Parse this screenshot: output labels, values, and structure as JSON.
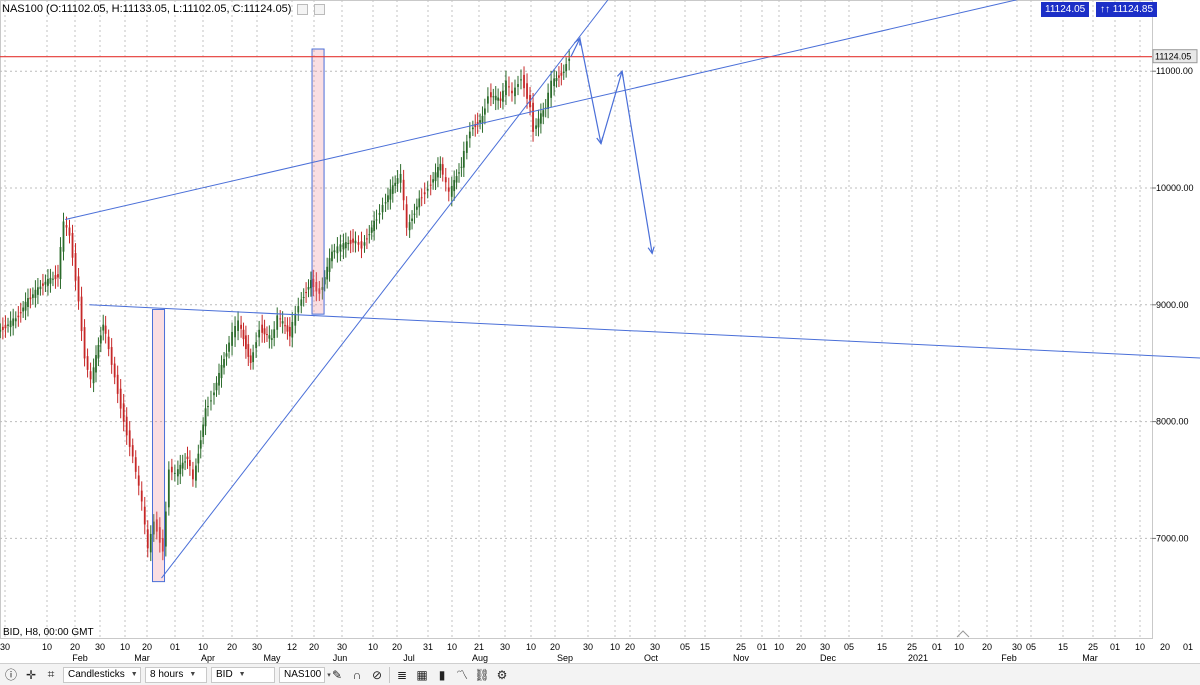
{
  "header": {
    "ohlc_text": "NAS100 (O:11102.05, H:11133.05, L:11102.05, C:11124.05)"
  },
  "badges": {
    "bid_price": "11124.05",
    "ask_price": "11124.85",
    "ask_arrows": "↑↑"
  },
  "footer_label": "BID, H8, 00:00 GMT",
  "chart_data": {
    "type": "candlestick",
    "symbol": "NAS100",
    "timeframe": "H8",
    "current_price": 11124.05,
    "price_ticks": [
      "11124.05",
      "11000.00",
      "10000.00",
      "9000.00",
      "8000.00",
      "7000.00"
    ],
    "date_ticks": [
      "30",
      "10",
      "20",
      "30",
      "10",
      "20",
      "01",
      "10",
      "20",
      "30",
      "12",
      "20",
      "30",
      "10",
      "20",
      "31",
      "10",
      "21",
      "30",
      "10",
      "20",
      "30",
      "10",
      "20",
      "30",
      "05",
      "15",
      "25",
      "01",
      "10",
      "20",
      "30",
      "05",
      "15",
      "25",
      "01",
      "10",
      "20",
      "30",
      "05",
      "15",
      "25",
      "01",
      "10",
      "20",
      "01",
      "10",
      "20"
    ],
    "month_labels": [
      "Feb",
      "Mar",
      "Apr",
      "May",
      "Jun",
      "Jul",
      "Aug",
      "Sep",
      "Oct",
      "Nov",
      "Dec",
      "2021",
      "Feb",
      "Mar"
    ],
    "ylim": [
      6350,
      11650
    ],
    "series": [
      {
        "points": [
          [
            "2020-01-28",
            8770
          ],
          [
            "2020-02-03",
            8880
          ],
          [
            "2020-02-07",
            9040
          ],
          [
            "2020-02-12",
            9180
          ],
          [
            "2020-02-17",
            9250
          ],
          [
            "2020-02-19",
            9700
          ],
          [
            "2020-02-21",
            9600
          ],
          [
            "2020-02-24",
            9040
          ],
          [
            "2020-02-26",
            8550
          ],
          [
            "2020-02-28",
            8350
          ],
          [
            "2020-03-03",
            8850
          ],
          [
            "2020-03-06",
            8500
          ],
          [
            "2020-03-09",
            8130
          ],
          [
            "2020-03-11",
            7900
          ],
          [
            "2020-03-13",
            7700
          ],
          [
            "2020-03-16",
            7300
          ],
          [
            "2020-03-18",
            6900
          ],
          [
            "2020-03-20",
            7150
          ],
          [
            "2020-03-23",
            6900
          ],
          [
            "2020-03-25",
            7600
          ],
          [
            "2020-03-27",
            7550
          ],
          [
            "2020-03-31",
            7700
          ],
          [
            "2020-04-02",
            7500
          ],
          [
            "2020-04-06",
            8100
          ],
          [
            "2020-04-08",
            8200
          ],
          [
            "2020-04-13",
            8600
          ],
          [
            "2020-04-15",
            8750
          ],
          [
            "2020-04-17",
            8850
          ],
          [
            "2020-04-21",
            8500
          ],
          [
            "2020-04-24",
            8800
          ],
          [
            "2020-04-28",
            8700
          ],
          [
            "2020-04-30",
            8900
          ],
          [
            "2020-05-04",
            8750
          ],
          [
            "2020-05-07",
            9000
          ],
          [
            "2020-05-11",
            9200
          ],
          [
            "2020-05-14",
            9100
          ],
          [
            "2020-05-18",
            9450
          ],
          [
            "2020-05-21",
            9500
          ],
          [
            "2020-05-25",
            9550
          ],
          [
            "2020-05-28",
            9500
          ],
          [
            "2020-06-01",
            9700
          ],
          [
            "2020-06-04",
            9850
          ],
          [
            "2020-06-08",
            10050
          ],
          [
            "2020-06-10",
            10100
          ],
          [
            "2020-06-12",
            9650
          ],
          [
            "2020-06-16",
            9900
          ],
          [
            "2020-06-19",
            10000
          ],
          [
            "2020-06-23",
            10200
          ],
          [
            "2020-06-26",
            9950
          ],
          [
            "2020-06-30",
            10200
          ],
          [
            "2020-07-03",
            10500
          ],
          [
            "2020-07-07",
            10600
          ],
          [
            "2020-07-09",
            10800
          ],
          [
            "2020-07-13",
            10750
          ],
          [
            "2020-07-15",
            10900
          ],
          [
            "2020-07-17",
            10800
          ],
          [
            "2020-07-20",
            10950
          ],
          [
            "2020-07-23",
            10700
          ],
          [
            "2020-07-24",
            10500
          ],
          [
            "2020-07-28",
            10700
          ],
          [
            "2020-07-30",
            10900
          ],
          [
            "2020-08-03",
            11000
          ],
          [
            "2020-08-05",
            11124
          ]
        ]
      }
    ],
    "drawings": {
      "upper_trendline": [
        [
          "2020-02-19",
          9730
        ],
        [
          "2021-01-15",
          11700
        ]
      ],
      "lower_trendline": [
        [
          "2020-02-27",
          9000
        ],
        [
          "2021-03-22",
          8520
        ]
      ],
      "support_trendline": [
        [
          "2020-03-22",
          6660
        ],
        [
          "2020-08-08",
          11300
        ]
      ],
      "horizontal_line": 11124.05,
      "projection_path": [
        [
          "2020-08-08",
          11280
        ],
        [
          "2020-08-15",
          10380
        ],
        [
          "2020-08-22",
          11000
        ],
        [
          "2020-09-01",
          9440
        ]
      ],
      "highlight_boxes": [
        {
          "from": "2020-03-19",
          "to": "2020-03-23",
          "top": 8960,
          "bottom": 6630
        },
        {
          "from": "2020-05-11",
          "to": "2020-05-15",
          "top": 11190,
          "bottom": 8920
        }
      ]
    }
  },
  "toolbar": {
    "chart_type": "Candlesticks",
    "interval": "8 hours",
    "price_type": "BID",
    "symbol": "NAS100",
    "symbol_caret": "▾",
    "caret": "▼"
  }
}
